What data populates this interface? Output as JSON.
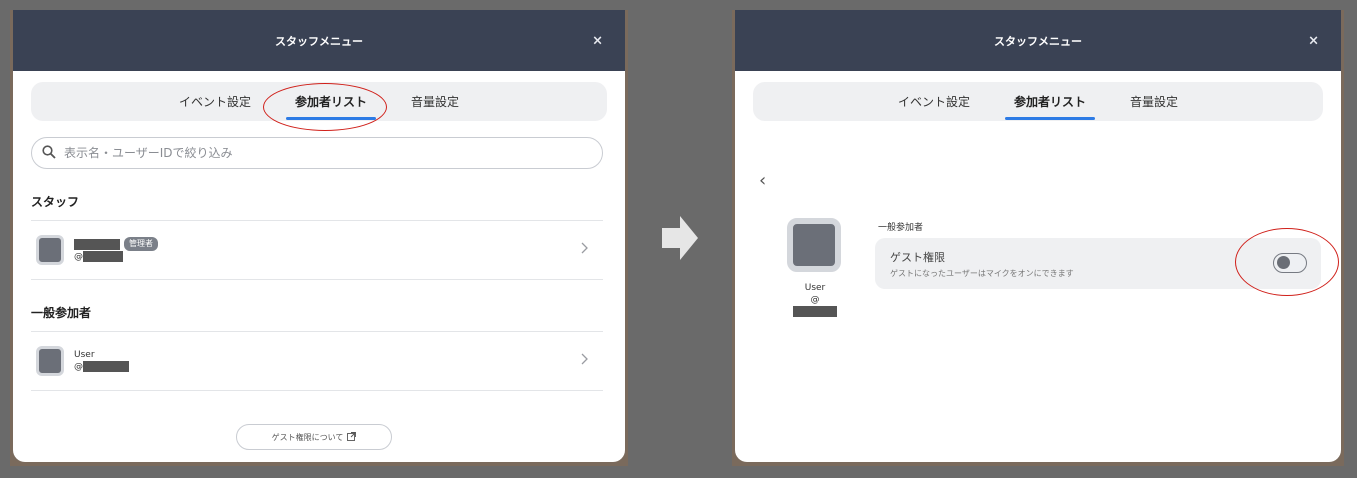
{
  "left": {
    "header_title": "スタッフメニュー",
    "close": "×",
    "tabs": [
      "イベント設定",
      "参加者リスト",
      "音量設定"
    ],
    "search_placeholder": "表示名・ユーザーIDで絞り込み",
    "staff_section": "スタッフ",
    "staff_row": {
      "at": "@",
      "badge": "管理者"
    },
    "general_section": "一般参加者",
    "general_row": {
      "name": "User",
      "at": "@"
    },
    "guest_button": "ゲスト権限について"
  },
  "right": {
    "header_title": "スタッフメニュー",
    "close": "×",
    "tabs": [
      "イベント設定",
      "参加者リスト",
      "音量設定"
    ],
    "back": "‹",
    "user_name": "User",
    "user_at": "@",
    "section_label": "一般参加者",
    "permission_title": "ゲスト権限",
    "permission_desc": "ゲストになったユーザーはマイクをオンにできます",
    "guest_toggle_on": false
  },
  "icons": {
    "search": "search-icon",
    "external": "external-link-icon",
    "chevron": "chevron-right-icon",
    "arrow": "arrow-right-icon"
  },
  "colors": {
    "header": "#3a4254",
    "tab_underline": "#2d7be5",
    "annotation": "#d0201a"
  }
}
